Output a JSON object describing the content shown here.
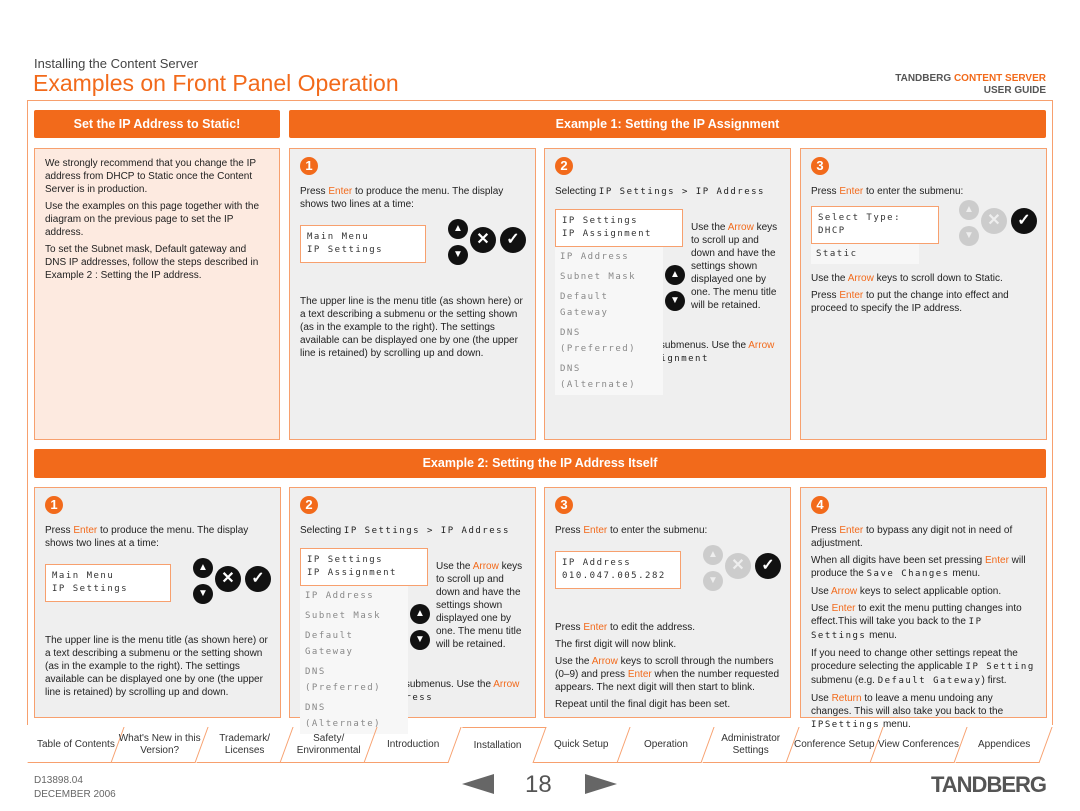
{
  "header": {
    "section": "Installing the Content Server",
    "title": "Examples on Front Panel Operation",
    "brand_a": "TANDBERG ",
    "brand_b": "CONTENT SERVER",
    "guide": "USER GUIDE"
  },
  "colors": {
    "accent": "#f26a1b",
    "panel": "#efefef",
    "peach": "#fdeae0"
  },
  "static": {
    "bar": "Set the IP Address to Static!",
    "paras": [
      [
        {
          "t": "We strongly recommend that you change the IP address from DHCP to Static once the Content Server is in production."
        }
      ],
      [
        {
          "t": "Use the examples on this page together with the diagram on the previous page to set the IP address."
        }
      ],
      [
        {
          "t": "To set the Subnet mask, Default gateway and DNS IP addresses, follow the steps described in Example 2 : Setting the IP address."
        }
      ]
    ]
  },
  "ex1": {
    "bar": "Example 1: Setting the IP Assignment",
    "s1": {
      "num": "1",
      "intro": [
        {
          "t": "Press "
        },
        {
          "t": "Enter",
          "hl": 1
        },
        {
          "t": " to produce the menu. The display shows two lines at a time:"
        }
      ],
      "lcd": [
        "Main Menu",
        "IP Settings"
      ],
      "after": [
        {
          "t": "The upper line is the menu title (as shown here) or a text describing a submenu or the setting shown (as in the example to the right). The settings available can be displayed one by one (the upper line is retained) by scrolling up and down."
        }
      ]
    },
    "s2": {
      "num": "2",
      "intro": [
        {
          "t": "Selecting "
        },
        {
          "t": "IP Settings > IP Address",
          "lcd": 1
        }
      ],
      "lcd": [
        "IP Settings",
        "IP Assignment"
      ],
      "list": [
        "IP Address",
        "Subnet Mask",
        "Default Gateway",
        "DNS (Preferred)",
        "DNS (Alternate)"
      ],
      "side": [
        {
          "t": "Use the "
        },
        {
          "t": "Arrow",
          "hl": 1
        },
        {
          "t": " keys to scroll up and down and have the settings shown displayed one by one. The menu title will be retained."
        }
      ],
      "after": [
        {
          "t": "The IP Settings has six submenus. Use the "
        },
        {
          "t": "Arrow",
          "hl": 1
        },
        {
          "t": " keys to locate "
        },
        {
          "t": "IP Assignment",
          "lcd": 1
        }
      ]
    },
    "s3": {
      "num": "3",
      "intro": [
        {
          "t": "Press "
        },
        {
          "t": "Enter",
          "hl": 1
        },
        {
          "t": " to enter the submenu:"
        }
      ],
      "lcd": [
        "Select Type:",
        "DHCP"
      ],
      "list": [
        "Static"
      ],
      "after": [
        [
          {
            "t": "Use the "
          },
          {
            "t": "Arrow",
            "hl": 1
          },
          {
            "t": " keys to scroll down to Static."
          }
        ],
        [
          {
            "t": "Press "
          },
          {
            "t": "Enter",
            "hl": 1
          },
          {
            "t": " to put the change into effect and proceed to specify the IP address."
          }
        ]
      ]
    }
  },
  "ex2": {
    "bar": "Example 2: Setting the IP Address Itself",
    "s1": {
      "num": "1",
      "intro": [
        {
          "t": "Press "
        },
        {
          "t": "Enter",
          "hl": 1
        },
        {
          "t": " to produce the menu. The display shows two lines at a time:"
        }
      ],
      "lcd": [
        "Main Menu",
        "IP Settings"
      ],
      "after": [
        {
          "t": "The upper line is the menu title (as shown here) or a text describing a submenu or the setting shown (as in the example to the right). The settings available can be displayed one by one (the upper line is retained) by scrolling up and down."
        }
      ]
    },
    "s2": {
      "num": "2",
      "intro": [
        {
          "t": "Selecting "
        },
        {
          "t": "IP Settings > IP Address",
          "lcd": 1
        }
      ],
      "lcd": [
        "IP Settings",
        "IP Assignment"
      ],
      "list": [
        "IP Address",
        "Subnet Mask",
        "Default Gateway",
        "DNS (Preferred)",
        "DNS (Alternate)"
      ],
      "side": [
        {
          "t": "Use the "
        },
        {
          "t": "Arrow",
          "hl": 1
        },
        {
          "t": " keys to scroll up and down and have the settings shown displayed one by one. The menu title will be retained."
        }
      ],
      "after": [
        {
          "t": "The IP Settings has six submenus. Use the "
        },
        {
          "t": "Arrow",
          "hl": 1
        },
        {
          "t": " keys to locate "
        },
        {
          "t": "IP Address",
          "lcd": 1
        }
      ]
    },
    "s3": {
      "num": "3",
      "intro": [
        {
          "t": "Press "
        },
        {
          "t": "Enter",
          "hl": 1
        },
        {
          "t": " to enter the submenu:"
        }
      ],
      "lcd": [
        "IP Address",
        "010.047.005.282"
      ],
      "after": [
        [
          {
            "t": "Press "
          },
          {
            "t": "Enter",
            "hl": 1
          },
          {
            "t": " to edit the address."
          }
        ],
        [
          {
            "t": "The first digit will now blink."
          }
        ],
        [
          {
            "t": "Use the "
          },
          {
            "t": "Arrow",
            "hl": 1
          },
          {
            "t": " keys to scroll through the numbers (0–9) and press "
          },
          {
            "t": "Enter",
            "hl": 1
          },
          {
            "t": " when the number requested appears. The next digit will then start to blink."
          }
        ],
        [
          {
            "t": "Repeat until the final digit has been set."
          }
        ]
      ]
    },
    "s4": {
      "num": "4",
      "after": [
        [
          {
            "t": "Press "
          },
          {
            "t": "Enter",
            "hl": 1
          },
          {
            "t": " to bypass any digit not in need of adjustment."
          }
        ],
        [
          {
            "t": "When all digits have been set pressing "
          },
          {
            "t": "Enter",
            "hl": 1
          },
          {
            "t": " will produce the "
          },
          {
            "t": "Save Changes",
            "lcd": 1
          },
          {
            "t": " menu."
          }
        ],
        [
          {
            "t": "Use "
          },
          {
            "t": "Arrow",
            "hl": 1
          },
          {
            "t": " keys to select applicable option."
          }
        ],
        [
          {
            "t": "Use "
          },
          {
            "t": "Enter",
            "hl": 1
          },
          {
            "t": " to exit the menu putting changes into effect.This will take you back to the "
          },
          {
            "t": "IP Settings",
            "lcd": 1
          },
          {
            "t": " menu."
          }
        ],
        [
          {
            "t": "If you need to change other settings repeat the procedure selecting the applicable "
          },
          {
            "t": "IP Setting",
            "lcd": 1
          },
          {
            "t": " submenu (e.g. "
          },
          {
            "t": "Default Gateway",
            "lcd": 1
          },
          {
            "t": ") first."
          }
        ],
        [
          {
            "t": "Use "
          },
          {
            "t": "Return",
            "hl": 1
          },
          {
            "t": " to leave a menu undoing any changes. This will also take you back to the "
          },
          {
            "t": "IPSettings",
            "lcd": 1
          },
          {
            "t": " menu."
          }
        ]
      ]
    }
  },
  "keys": {
    "up": "▲",
    "down": "▼",
    "cancel": "✕",
    "enter": "✓"
  },
  "tabs": [
    "Table of Contents",
    "What's New in this Version?",
    "Trademark/ Licenses",
    "Safety/ Environmental",
    "Introduction",
    "Installation",
    "Quick Setup",
    "Operation",
    "Administrator Settings",
    "Conference Setup",
    "View Conferences",
    "Appendices"
  ],
  "active_tab": "Installation",
  "footer": {
    "doc": "D13898.04",
    "date": "DECEMBER 2006",
    "page": "18",
    "logo": "TANDBERG"
  }
}
